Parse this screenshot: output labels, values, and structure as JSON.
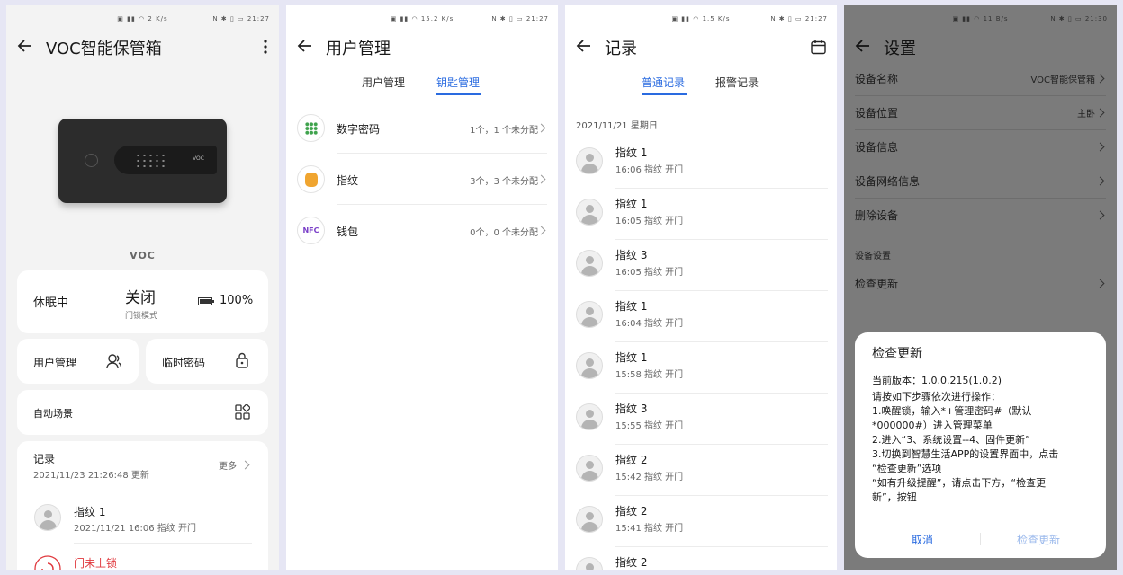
{
  "status_bar": {
    "p1": {
      "time": "21:27",
      "speed": "2 K/s"
    },
    "p2": {
      "time": "21:27",
      "speed": "15.2 K/s"
    },
    "p3": {
      "time": "21:27",
      "speed": "1.5 K/s"
    },
    "p4": {
      "time": "21:30",
      "speed": "11 B/s"
    }
  },
  "device": {
    "title": "VOC智能保管箱",
    "brand": "VOC",
    "box_logo": "VOC",
    "sleep_status": "休眠中",
    "lock_state": "关闭",
    "lock_mode": "门锁模式",
    "battery": "100%",
    "user_mgmt": "用户管理",
    "temp_pwd": "临时密码",
    "auto_scene": "自动场景",
    "records_title": "记录",
    "records_updated": "2021/11/23 21:26:48 更新",
    "more": "更多",
    "last_record_name": "指纹 1",
    "last_record_time": "2021/11/21 16:06 指纹 开门",
    "alert": "门未上锁"
  },
  "users": {
    "title": "用户管理",
    "tabs": [
      "用户管理",
      "钥匙管理"
    ],
    "keys": [
      {
        "name": "数字密码",
        "count": "1个，1 个未分配"
      },
      {
        "name": "指纹",
        "count": "3个，3 个未分配"
      },
      {
        "name": "钱包",
        "count": "0个，0 个未分配",
        "badge": "NFC"
      }
    ]
  },
  "records": {
    "title": "记录",
    "tabs": [
      "普通记录",
      "报警记录"
    ],
    "date": "2021/11/21 星期日",
    "items": [
      {
        "name": "指纹 1",
        "time": "16:06 指纹 开门"
      },
      {
        "name": "指纹 1",
        "time": "16:05 指纹 开门"
      },
      {
        "name": "指纹 3",
        "time": "16:05 指纹 开门"
      },
      {
        "name": "指纹 1",
        "time": "16:04 指纹 开门"
      },
      {
        "name": "指纹 1",
        "time": "15:58 指纹 开门"
      },
      {
        "name": "指纹 3",
        "time": "15:55 指纹 开门"
      },
      {
        "name": "指纹 2",
        "time": "15:42 指纹 开门"
      },
      {
        "name": "指纹 2",
        "time": "15:41 指纹 开门"
      },
      {
        "name": "指纹 2",
        "time": ""
      }
    ]
  },
  "settings": {
    "title": "设置",
    "rows": [
      {
        "label": "设备名称",
        "value": "VOC智能保管箱"
      },
      {
        "label": "设备位置",
        "value": "主卧"
      },
      {
        "label": "设备信息",
        "value": ""
      },
      {
        "label": "设备网络信息",
        "value": ""
      },
      {
        "label": "删除设备",
        "value": ""
      }
    ],
    "section": "设备设置",
    "check_update": "检查更新",
    "dialog": {
      "title": "检查更新",
      "version": "当前版本：1.0.0.215(1.0.2)",
      "lines": [
        "请按如下步骤依次进行操作：",
        "1.唤醒锁，输入*+管理密码#（默认",
        "*000000#）进入管理菜单",
        "2.进入“3、系统设置--4、固件更新”",
        "3.切换到智慧生活APP的设置界面中，点击",
        "“检查更新”选项",
        "“如有升级提醒”，请点击下方，“检查更",
        "新”，按钮"
      ],
      "cancel": "取消",
      "confirm": "检查更新"
    }
  },
  "colors": {
    "accent": "#2a6be0",
    "alert": "#e0393e",
    "keypad_green": "#3fa34d",
    "finger_orange": "#f0a530",
    "nfc_purple": "#7a3fc8"
  },
  "icons": [
    "back-arrow-icon",
    "more-vert-icon",
    "battery-icon",
    "user-icon",
    "lock-icon",
    "grid-icon",
    "chevron-right-icon",
    "calendar-icon",
    "keypad-icon",
    "fingerprint-icon",
    "nfc-icon",
    "avatar-icon",
    "alert-icon"
  ]
}
